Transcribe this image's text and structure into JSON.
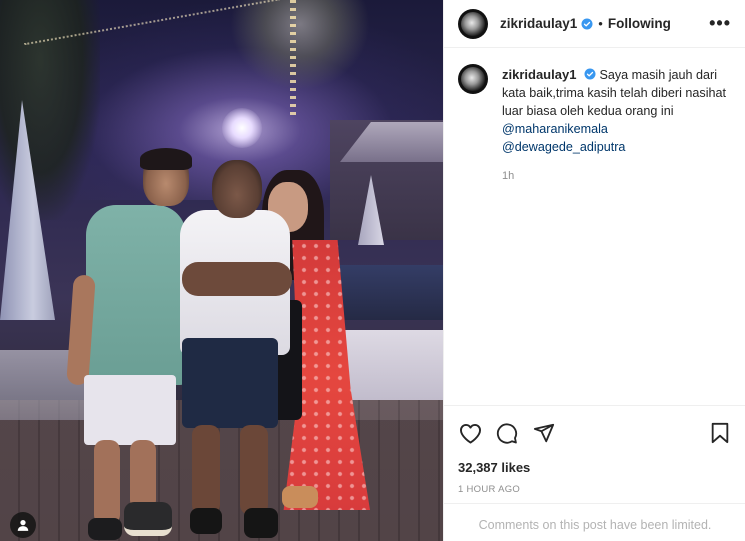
{
  "post": {
    "username": "zikridaulay1",
    "verified": true,
    "separator": "•",
    "follow_label": "Following",
    "more_label": "•••",
    "caption_text": "Saya masih jauh dari kata baik,trima kasih telah diberi nasihat luar biasa oleh kedua orang ini",
    "mentions": [
      "@maharanikemala",
      "@dewagede_adiputra"
    ],
    "caption_time": "1h",
    "likes": "32,387 likes",
    "time_ago": "1 HOUR AGO",
    "comments_notice": "Comments on this post have been limited."
  },
  "icons": {
    "like": "heart-icon",
    "comment": "comment-icon",
    "share": "share-icon",
    "save": "bookmark-icon",
    "verified": "verified-badge-icon",
    "more": "more-options-icon"
  },
  "colors": {
    "verified_blue": "#3897f0",
    "mention_blue": "#00376b",
    "muted": "#8e8e8e"
  }
}
